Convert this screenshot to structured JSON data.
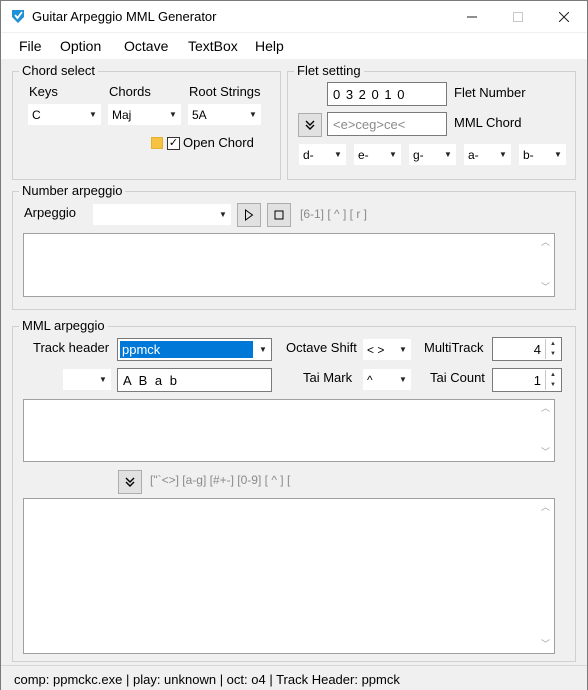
{
  "window": {
    "title": "Guitar Arpeggio MML Generator"
  },
  "menu": [
    "File",
    "Option",
    "Octave",
    "TextBox",
    "Help"
  ],
  "chord_select": {
    "title": "Chord select",
    "keys_label": "Keys",
    "chords_label": "Chords",
    "root_strings_label": "Root Strings",
    "keys_value": "C",
    "chords_value": "Maj",
    "root_strings_value": "5A",
    "open_chord_label": "Open Chord",
    "open_chord_checked": "✓",
    "indicator_color": "#f5c242"
  },
  "flet_setting": {
    "title": "Flet setting",
    "flet_number_value": "0 3 2 0 1 0",
    "flet_number_label": "Flet Number",
    "mml_chord_value": "<e>ceg>ce<",
    "mml_chord_label": "MML Chord",
    "string_notes": [
      "d-",
      "e-",
      "g-",
      "a-",
      "b-"
    ]
  },
  "number_arpeggio": {
    "title": "Number arpeggio",
    "arpeggio_label": "Arpeggio",
    "arpeggio_value": "",
    "hint": "[6-1] [ ^ ] [ r ]"
  },
  "mml_arpeggio": {
    "title": "MML arpeggio",
    "track_header_label": "Track header",
    "track_header_value": "ppmck",
    "octave_shift_label": "Octave Shift",
    "octave_shift_value": "< >",
    "multitrack_label": "MultiTrack",
    "multitrack_value": "4",
    "small_combo_value": "",
    "notes_value": "A B a b",
    "tai_mark_label": "Tai Mark",
    "tai_mark_value": "^",
    "tai_count_label": "Tai Count",
    "tai_count_value": "1",
    "hint": "[\"`<>] [a-g] [#+-] [0-9] [ ^ ] ["
  },
  "status": "comp: ppmckc.exe | play: unknown | oct: o4 | Track Header: ppmck"
}
